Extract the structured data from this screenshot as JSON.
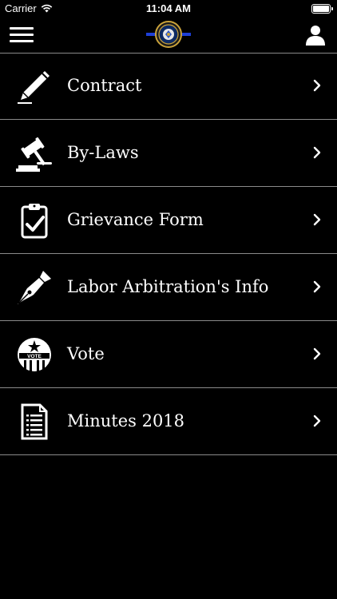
{
  "status_bar": {
    "carrier": "Carrier",
    "time": "11:04 AM"
  },
  "nav": {
    "menu_icon": "hamburger-menu-icon",
    "logo_icon": "badge-logo-icon",
    "profile_icon": "person-icon"
  },
  "menu": {
    "items": [
      {
        "label": "Contract",
        "icon": "pencil-icon"
      },
      {
        "label": "By-Laws",
        "icon": "gavel-icon"
      },
      {
        "label": "Grievance Form",
        "icon": "clipboard-check-icon"
      },
      {
        "label": "Labor Arbitration's Info",
        "icon": "fountain-pen-icon"
      },
      {
        "label": "Vote",
        "icon": "vote-icon",
        "badge_text": "VOTE"
      },
      {
        "label": "Minutes 2018",
        "icon": "document-icon"
      }
    ]
  },
  "colors": {
    "background": "#000000",
    "text": "#ffffff",
    "divider": "#8a8a8a",
    "logo_bar": "#1e3fd6"
  }
}
